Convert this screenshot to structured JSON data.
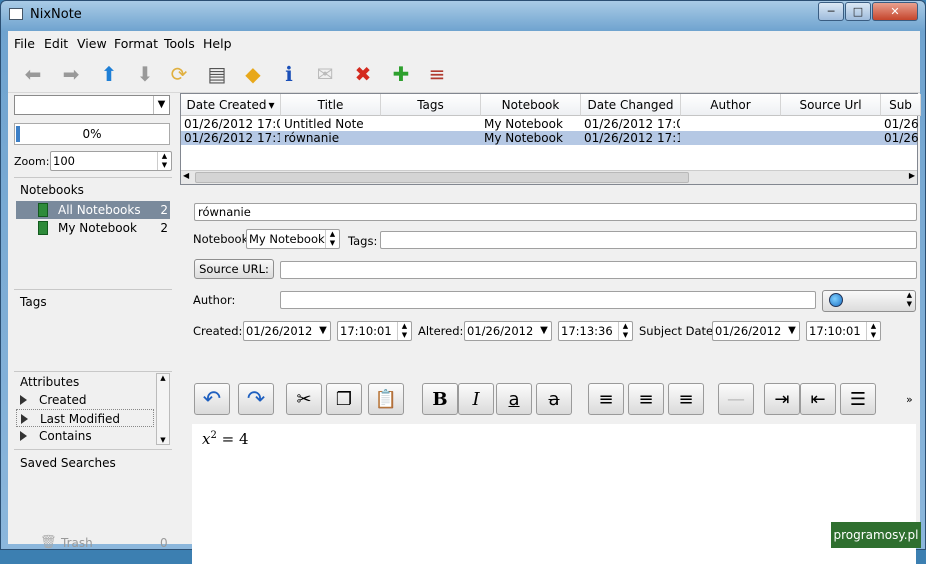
{
  "window": {
    "title": "NixNote",
    "min": "─",
    "max": "□",
    "close": "✕"
  },
  "menu": [
    "File",
    "Edit",
    "View",
    "Format",
    "Tools",
    "Help"
  ],
  "toolbar": [
    {
      "name": "back-icon",
      "glyph": "⬅",
      "color": "#999999"
    },
    {
      "name": "forward-icon",
      "glyph": "➡",
      "color": "#999999"
    },
    {
      "name": "up-icon",
      "glyph": "⬆",
      "color": "#1e7fd6"
    },
    {
      "name": "down-icon",
      "glyph": "⬇",
      "color": "#999999"
    },
    {
      "name": "sync-icon",
      "glyph": "⟳",
      "color": "#e0b040"
    },
    {
      "name": "print-icon",
      "glyph": "▤",
      "color": "#555555"
    },
    {
      "name": "tag-icon",
      "glyph": "◆",
      "color": "#e8a81a"
    },
    {
      "name": "info-icon",
      "glyph": "ℹ",
      "color": "#1a4fb8"
    },
    {
      "name": "email-icon",
      "glyph": "✉",
      "color": "#bbbbbb"
    },
    {
      "name": "delete-icon",
      "glyph": "✖",
      "color": "#d42a1f"
    },
    {
      "name": "add-note-icon",
      "glyph": "✚",
      "color": "#2ea02e"
    },
    {
      "name": "notebooks-icon",
      "glyph": "≡",
      "color": "#b03a2e"
    }
  ],
  "left": {
    "search_value": "",
    "progress": "0%",
    "zoom_label": "Zoom:",
    "zoom_value": "100",
    "notebooks_title": "Notebooks",
    "notebooks": [
      {
        "label": "All Notebooks",
        "count": "2",
        "selected": true
      },
      {
        "label": "My Notebook",
        "count": "2",
        "selected": false
      }
    ],
    "tags_title": "Tags",
    "attributes_title": "Attributes",
    "attributes": [
      "Created",
      "Last Modified",
      "Contains"
    ],
    "saved_searches": "Saved Searches",
    "trash_label": "Trash",
    "trash_count": "0"
  },
  "notes": {
    "columns": [
      "Date Created",
      "Title",
      "Tags",
      "Notebook",
      "Date Changed",
      "Author",
      "Source Url",
      "Sub"
    ],
    "rows": [
      {
        "created": "01/26/2012 17:0...",
        "title": "Untitled Note",
        "tags": "",
        "notebook": "My Notebook",
        "changed": "01/26/2012 17:0...",
        "author": "",
        "url": "",
        "sub": "01/26"
      },
      {
        "created": "01/26/2012 17:1...",
        "title": "równanie",
        "tags": "",
        "notebook": "My Notebook",
        "changed": "01/26/2012 17:1...",
        "author": "",
        "url": "",
        "sub": "01/26"
      }
    ],
    "sort_indicator": "▾"
  },
  "note": {
    "title": "równanie",
    "notebook_label": "Notebook",
    "notebook_value": "My Notebook",
    "tags_label": "Tags:",
    "tags_value": "",
    "source_button": "Source URL:",
    "source_value": "",
    "author_label": "Author:",
    "author_value": "",
    "created_label": "Created:",
    "created_date": "01/26/2012",
    "created_time": "17:10:01",
    "altered_label": "Altered:",
    "altered_date": "01/26/2012",
    "altered_time": "17:13:36",
    "subject_label": "Subject Date:",
    "subject_date": "01/26/2012",
    "subject_time": "17:10:01",
    "more": "»",
    "content_x": "x",
    "content_sup": "2",
    "content_rest": " = 4"
  },
  "format_buttons": [
    {
      "name": "undo-icon",
      "glyph": "↶"
    },
    {
      "name": "redo-icon",
      "glyph": "↷"
    },
    {
      "name": "cut-icon",
      "glyph": "✂"
    },
    {
      "name": "copy-icon",
      "glyph": "❐"
    },
    {
      "name": "paste-icon",
      "glyph": "📋"
    },
    {
      "name": "bold-icon",
      "glyph": "B"
    },
    {
      "name": "italic-icon",
      "glyph": "I"
    },
    {
      "name": "underline-icon",
      "glyph": "a"
    },
    {
      "name": "strikethrough-icon",
      "glyph": "a"
    },
    {
      "name": "align-left-icon",
      "glyph": "≡"
    },
    {
      "name": "align-center-icon",
      "glyph": "≡"
    },
    {
      "name": "align-right-icon",
      "glyph": "≡"
    },
    {
      "name": "horizontal-rule-icon",
      "glyph": "—"
    },
    {
      "name": "indent-icon",
      "glyph": "⇥"
    },
    {
      "name": "outdent-icon",
      "glyph": "⇤"
    },
    {
      "name": "bullet-list-icon",
      "glyph": "☰"
    }
  ],
  "watermark": "programosy.pl"
}
